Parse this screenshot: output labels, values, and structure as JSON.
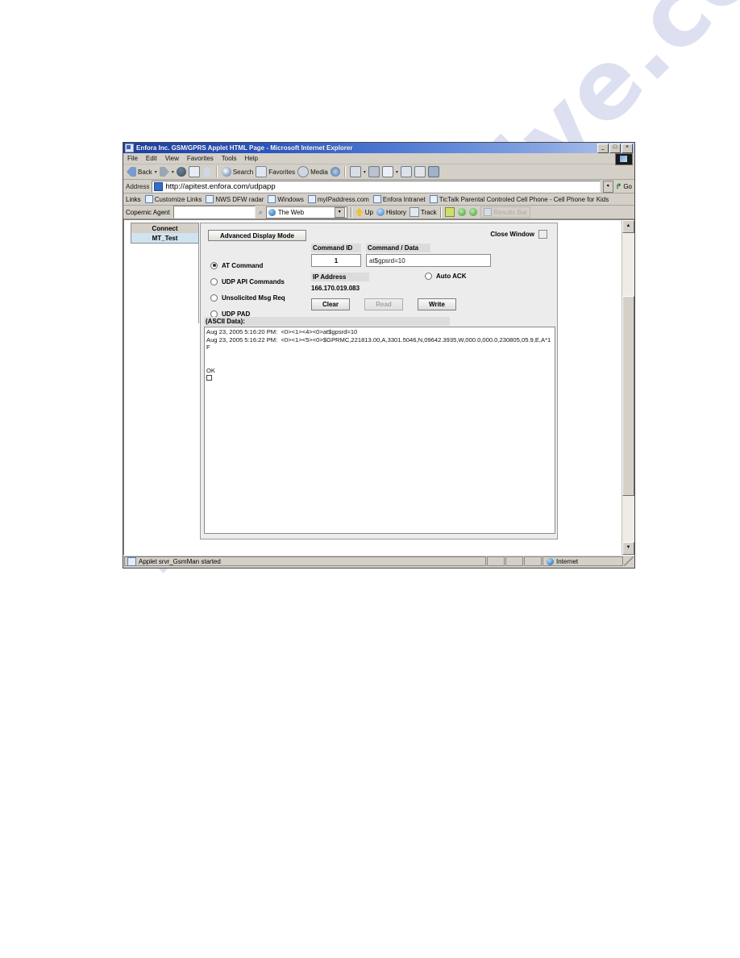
{
  "window": {
    "title": "Enfora Inc. GSM/GPRS Applet HTML Page - Microsoft Internet Explorer",
    "minimize": "_",
    "maximize": "□",
    "close": "×"
  },
  "menu": {
    "items": [
      "File",
      "Edit",
      "View",
      "Favorites",
      "Tools",
      "Help"
    ]
  },
  "toolbar": {
    "back": "Back",
    "forward": "",
    "search": "Search",
    "favorites": "Favorites",
    "media": "Media",
    "caret": "▾"
  },
  "address": {
    "label": "Address",
    "url": "http://apitest.enfora.com/udpapp",
    "dropdown": "▾",
    "go": "Go",
    "go_arrow": "↱"
  },
  "links": {
    "label": "Links",
    "items": [
      "Customize Links",
      "NWS DFW radar",
      "Windows",
      "myIPaddress.com",
      "Enfora Intranet",
      "TicTalk Parental Controled Cell Phone - Cell Phone for Kids"
    ]
  },
  "copernic": {
    "label": "Copernic Agent",
    "search_value": "",
    "search_placeholder": "",
    "magnifier": "⌕",
    "engine": "The Web",
    "engine_arrow": "▾",
    "up": "Up",
    "history": "History",
    "track": "Track",
    "results_bar": "Results Bar"
  },
  "applet": {
    "tabs": [
      {
        "label": "Connect",
        "active": false
      },
      {
        "label": "MT_Test",
        "active": true
      }
    ],
    "advanced_display_mode": "Advanced Display Mode",
    "close_window_label": "Close Window",
    "close_window_checked": false,
    "modes": [
      {
        "label": "AT Command",
        "selected": true
      },
      {
        "label": "UDP API Commands",
        "selected": false
      },
      {
        "label": "Unsolicited Msg Req",
        "selected": false
      },
      {
        "label": "UDP PAD",
        "selected": false
      }
    ],
    "command_id_label": "Command ID",
    "command_id_value": "1",
    "command_data_label": "Command / Data",
    "command_data_value": "at$gpsrd=10",
    "ip_address_label": "IP Address",
    "ip_address_value": "166.170.019.083",
    "auto_ack_label": "Auto ACK",
    "auto_ack_checked": false,
    "buttons": [
      {
        "label": "Clear",
        "disabled": false
      },
      {
        "label": "Read",
        "disabled": true
      },
      {
        "label": "Write",
        "disabled": false
      }
    ],
    "ascii_label": "(ASCII Data):",
    "ascii_lines": [
      "Aug 23, 2005 5:16:20 PM:  <0><1><4><0>at$gpsrd=10",
      "Aug 23, 2005 5:16:22 PM:  <0><1><5><0>$GPRMC,221813.00,A,3301.5046,N,09642.3935,W,000.0,000.0,230805,05.9,E,A*1F",
      "",
      "OK"
    ]
  },
  "status": {
    "message": "Applet srvr_GsmMan started",
    "zone": "Internet"
  },
  "watermark": {
    "text": "manualshive.com"
  },
  "colors": {
    "title_bar": "#1f3f9e",
    "chrome": "#d4d0c8",
    "active_tab": "#cfe4f0",
    "panel": "#ececec",
    "field_header": "#dcdcdc"
  }
}
